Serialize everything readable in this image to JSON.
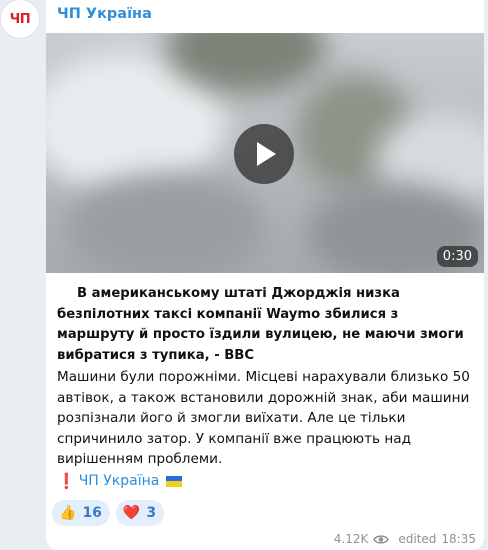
{
  "channel": {
    "avatar_text": "ЧП",
    "name": "ЧП Україна"
  },
  "video": {
    "duration": "0:30"
  },
  "message": {
    "headline": "В американському штаті Джорджія низка безпілотних таксі компанії Waymo збилися з маршруту й просто їздили вулицею, не маючи змоги вибратися з тупика, - BBC",
    "body": "Машини були порожніми. Місцеві нарахували близько 50 автівок, а також встановили дорожній знак, аби машини розпізнали його й змогли виїхати. Але це тільки спричинило затор. У компанії вже працюють над вирішенням проблеми.",
    "signature_link": "ЧП Україна"
  },
  "reactions": [
    {
      "emoji": "👍",
      "count": "16"
    },
    {
      "emoji": "❤️",
      "count": "3"
    }
  ],
  "meta": {
    "views": "4.12K",
    "edited_label": "edited",
    "time": "18:35"
  },
  "colors": {
    "accent": "#2f8fd8",
    "avatar_red": "#d6202a"
  }
}
